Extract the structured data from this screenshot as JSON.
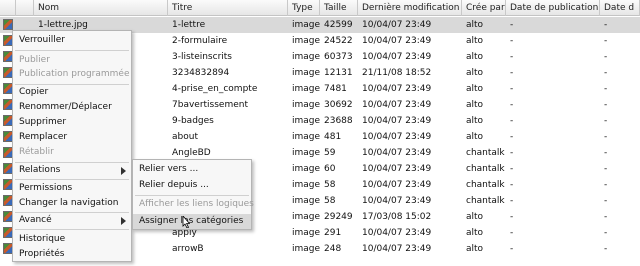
{
  "columns": {
    "nom": "Nom",
    "titre": "Titre",
    "type": "Type",
    "taille": "Taille",
    "modif": "Dernière modification",
    "cree": "Crée par",
    "pub": "Date de publication",
    "pub2": "Date d"
  },
  "rows": [
    {
      "nom": "1-lettre.jpg",
      "titre": "1-lettre",
      "type": "image",
      "taille": "42599",
      "modif": "10/04/07 23:49",
      "cree": "alto",
      "pub": "-",
      "pub2": "-"
    },
    {
      "nom": "",
      "titre": "2-formulaire",
      "type": "image",
      "taille": "24522",
      "modif": "10/04/07 23:49",
      "cree": "alto",
      "pub": "-",
      "pub2": "-"
    },
    {
      "nom": "",
      "titre": "3-listeinscrits",
      "type": "image",
      "taille": "60373",
      "modif": "10/04/07 23:49",
      "cree": "alto",
      "pub": "-",
      "pub2": "-"
    },
    {
      "nom": "",
      "titre": "3234832894",
      "type": "image",
      "taille": "12131",
      "modif": "21/11/08 18:52",
      "cree": "alto",
      "pub": "-",
      "pub2": "-"
    },
    {
      "nom": "pg",
      "titre": "4-prise_en_compte",
      "type": "image",
      "taille": "7481",
      "modif": "10/04/07 23:49",
      "cree": "alto",
      "pub": "-",
      "pub2": "-"
    },
    {
      "nom": "",
      "titre": "7bavertissement",
      "type": "image",
      "taille": "30692",
      "modif": "10/04/07 23:49",
      "cree": "alto",
      "pub": "-",
      "pub2": "-"
    },
    {
      "nom": "",
      "titre": "9-badges",
      "type": "image",
      "taille": "23688",
      "modif": "10/04/07 23:49",
      "cree": "alto",
      "pub": "-",
      "pub2": "-"
    },
    {
      "nom": "",
      "titre": "about",
      "type": "image",
      "taille": "481",
      "modif": "10/04/07 23:49",
      "cree": "alto",
      "pub": "-",
      "pub2": "-"
    },
    {
      "nom": "",
      "titre": "AngleBD",
      "type": "image",
      "taille": "59",
      "modif": "10/04/07 23:49",
      "cree": "chantalk",
      "pub": "-",
      "pub2": "-"
    },
    {
      "nom": "",
      "titre": "",
      "type": "image",
      "taille": "60",
      "modif": "10/04/07 23:49",
      "cree": "chantalk",
      "pub": "-",
      "pub2": "-"
    },
    {
      "nom": "",
      "titre": "",
      "type": "image",
      "taille": "58",
      "modif": "10/04/07 23:49",
      "cree": "chantalk",
      "pub": "-",
      "pub2": "-"
    },
    {
      "nom": "",
      "titre": "",
      "type": "image",
      "taille": "58",
      "modif": "10/04/07 23:49",
      "cree": "chantalk",
      "pub": "-",
      "pub2": "-"
    },
    {
      "nom": "",
      "titre": "",
      "type": "image",
      "taille": "29249",
      "modif": "17/03/08 15:02",
      "cree": "alto",
      "pub": "-",
      "pub2": "-"
    },
    {
      "nom": "",
      "titre": "apply",
      "type": "image",
      "taille": "291",
      "modif": "10/04/07 23:49",
      "cree": "alto",
      "pub": "-",
      "pub2": "-"
    },
    {
      "nom": "",
      "titre": "arrowB",
      "type": "image",
      "taille": "248",
      "modif": "10/04/07 23:49",
      "cree": "alto",
      "pub": "-",
      "pub2": "-"
    }
  ],
  "context_menu": {
    "verrouiller": "Verrouiller",
    "publier": "Publier",
    "publication_programmee": "Publication programmée",
    "copier": "Copier",
    "renommer": "Renommer/Déplacer",
    "supprimer": "Supprimer",
    "remplacer": "Remplacer",
    "retablir": "Rétablir",
    "relations": "Relations",
    "permissions": "Permissions",
    "changer_navigation": "Changer la navigation",
    "avance": "Avancé",
    "historique": "Historique",
    "proprietes": "Propriétés"
  },
  "relations_submenu": {
    "relier_vers": "Relier vers ...",
    "relier_depuis": "Relier depuis ...",
    "afficher_liens": "Afficher les liens logiques",
    "assigner_categories": "Assigner les catégories"
  },
  "colors": {
    "selected_row": "#d9d9d9",
    "menu_bg": "#f7f7f7",
    "disabled_text": "#9a9a9a",
    "highlight": "#d8d8d8"
  }
}
